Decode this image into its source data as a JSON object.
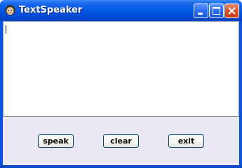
{
  "window": {
    "title": "TextSpeaker",
    "app_icon": "person-face-icon",
    "controls": {
      "minimize_icon": "minimize-icon",
      "maximize_icon": "maximize-icon",
      "close_icon": "close-icon"
    }
  },
  "editor": {
    "value": ""
  },
  "buttons": {
    "speak_label": "speak",
    "clear_label": "clear",
    "exit_label": "exit"
  },
  "colors": {
    "titlebar": "#0053e0",
    "close_button": "#d8512c",
    "panel": "#e9e8f3"
  }
}
